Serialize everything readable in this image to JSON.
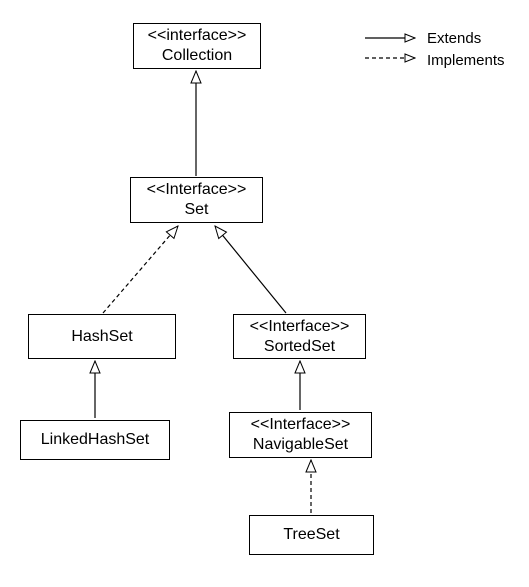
{
  "nodes": {
    "collection": {
      "stereotype": "<<interface>>",
      "name": "Collection"
    },
    "set": {
      "stereotype": "<<Interface>>",
      "name": "Set"
    },
    "hashset": {
      "name": "HashSet"
    },
    "sortedset": {
      "stereotype": "<<Interface>>",
      "name": "SortedSet"
    },
    "linkedhashset": {
      "name": "LinkedHashSet"
    },
    "navigableset": {
      "stereotype": "<<Interface>>",
      "name": "NavigableSet"
    },
    "treeset": {
      "name": "TreeSet"
    }
  },
  "legend": {
    "extends": "Extends",
    "implements": "Implements"
  }
}
